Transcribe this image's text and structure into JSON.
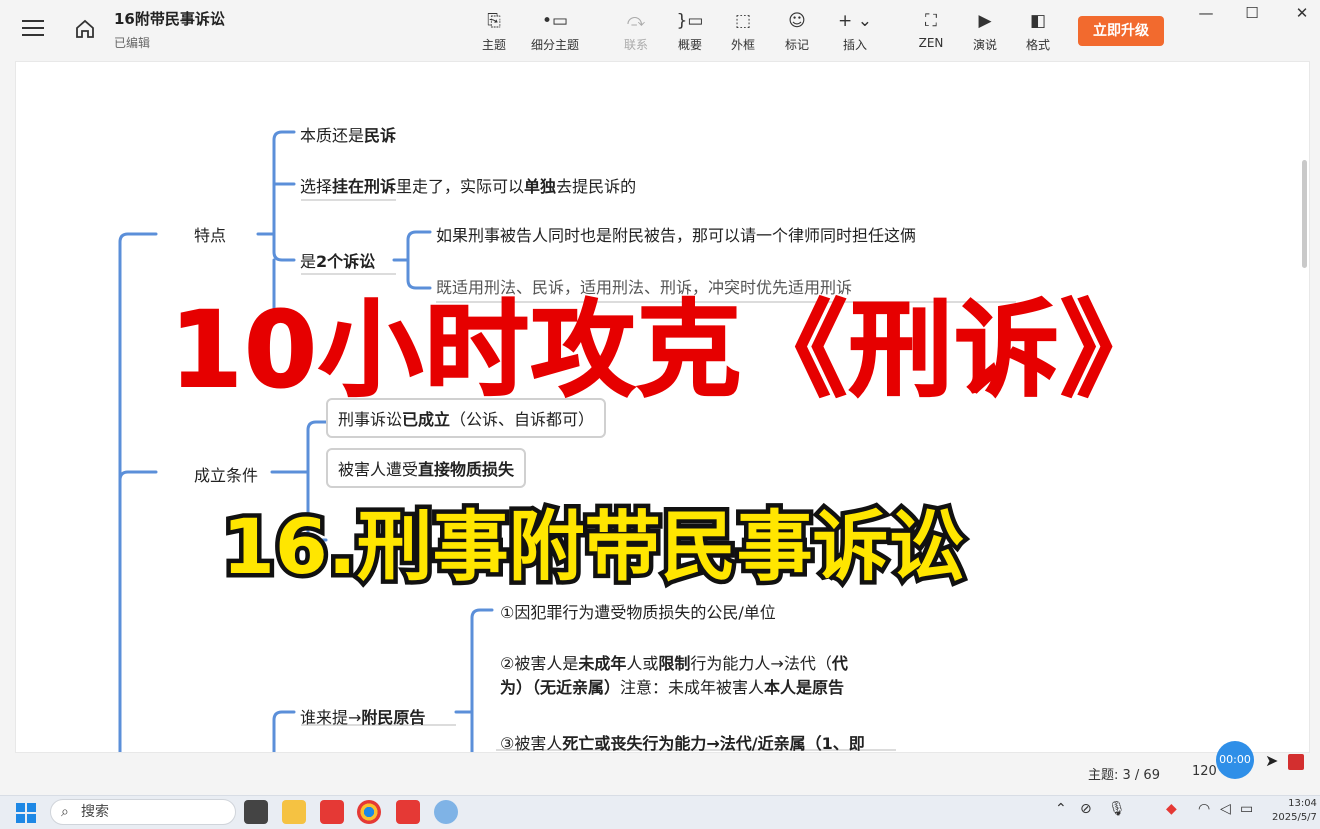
{
  "window": {
    "doc_title": "16附带民事诉讼",
    "doc_status": "已编辑",
    "upgrade_label": "立即升级"
  },
  "toolbar": [
    {
      "label": "主题",
      "icon": "topic-icon",
      "glyph": "⎘",
      "enabled": true
    },
    {
      "label": "细分主题",
      "icon": "subtopic-icon",
      "glyph": "•▭",
      "enabled": true
    },
    {
      "label": "联系",
      "icon": "relation-icon",
      "glyph": "⤼",
      "enabled": false
    },
    {
      "label": "概要",
      "icon": "summary-icon",
      "glyph": "}▭",
      "enabled": true
    },
    {
      "label": "外框",
      "icon": "boundary-icon",
      "glyph": "⬚",
      "enabled": true
    },
    {
      "label": "标记",
      "icon": "marker-icon",
      "glyph": "☺",
      "enabled": true
    },
    {
      "label": "插入",
      "icon": "insert-icon",
      "glyph": "+ ⌄",
      "enabled": true
    },
    {
      "label": "ZEN",
      "icon": "zen-icon",
      "glyph": "⛶",
      "enabled": true
    },
    {
      "label": "演说",
      "icon": "pitch-icon",
      "glyph": "▶",
      "enabled": true
    },
    {
      "label": "格式",
      "icon": "format-icon",
      "glyph": "◧",
      "enabled": true
    }
  ],
  "mindmap": {
    "features": {
      "label": "特点",
      "c1_pre": "本质还是",
      "c1_bold": "民诉",
      "c2_pre": "选择",
      "c2_bold1": "挂在刑诉",
      "c2_mid": "里走了，实际可以",
      "c2_bold2": "单独",
      "c2_post": "去提民诉的",
      "c3_pre": "是",
      "c3_bold": "2个诉讼",
      "c3a": "如果刑事被告人同时也是附民被告，那可以请一个律师同时担任这俩",
      "c3b": "既适用刑法、民诉，适用刑法、刑诉，冲突时优先适用刑诉"
    },
    "conditions": {
      "label": "成立条件",
      "c1_pre": "刑事诉讼",
      "c1_bold": "已成立",
      "c1_post": "（公诉、自诉都可）",
      "c2_pre": "被害人遭受",
      "c2_bold": "直接物质损失"
    },
    "who": {
      "label_pre": "谁来提→",
      "label_bold": "附民原告",
      "c1": "①因犯罪行为遭受物质损失的公民/单位",
      "c2_l1_pre": "②被害人是",
      "c2_l1_b1": "未成年",
      "c2_l1_m1": "人或",
      "c2_l1_b2": "限制",
      "c2_l1_m2": "行为能力人→法代（",
      "c2_l1_b3": "代",
      "c2_l2_b1": "为）（无近亲属）",
      "c2_l2_m": "注意：未成年被害人",
      "c2_l2_b2": "本人是原告",
      "c3_pre": "③被害人",
      "c3_bold": "死亡或丧失行为能力→法代/近亲属（1、即"
    }
  },
  "overlay": {
    "big_title": "10小时攻克《刑诉》",
    "sub_title": "16.刑事附带民事诉讼"
  },
  "status": {
    "topic_count": "主题: 3 / 69",
    "zoom": "120",
    "record_time": "00:00"
  },
  "taskbar": {
    "search_placeholder": "搜索",
    "time": "13:04",
    "date": "2025/5/7"
  }
}
